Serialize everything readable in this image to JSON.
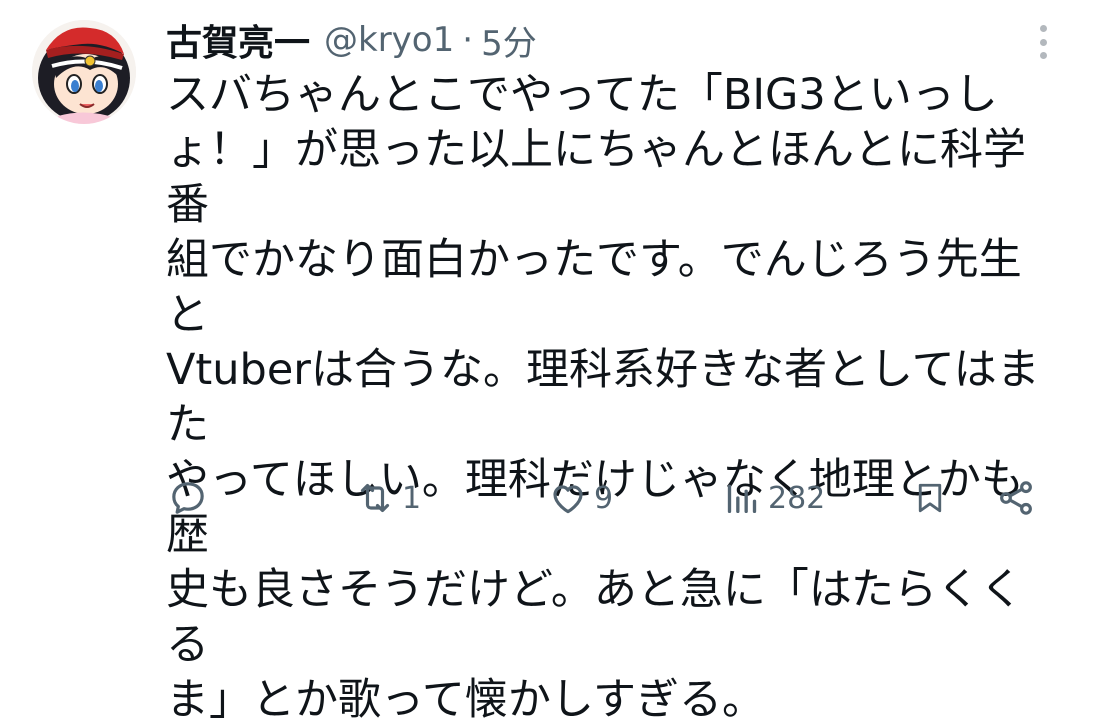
{
  "tweet": {
    "display_name": "古賀亮一",
    "handle": "@kryo1",
    "separator": "·",
    "time": "5分",
    "text": "スバちゃんとこでやってた「BIG3といっし\nょ！」が思った以上にちゃんとほんとに科学番\n組でかなり面白かったです。でんじろう先生と\nVtuberは合うな。理科系好きな者としてはまた\nやってほしい。理科だけじゃなく地理とかも歴\n史も良さそうだけど。あと急に「はたらくくる\nま」とか歌って懐かしすぎる。"
  },
  "actions": {
    "reply_icon": "reply-icon",
    "retweet_icon": "retweet-icon",
    "retweet_count": "1",
    "like_icon": "heart-icon",
    "like_count": "9",
    "views_icon": "views-chart-icon",
    "views_count": "282",
    "bookmark_icon": "bookmark-icon",
    "share_icon": "share-icon"
  },
  "colors": {
    "text": "#0f1419",
    "muted": "#536471",
    "background": "#ffffff"
  }
}
